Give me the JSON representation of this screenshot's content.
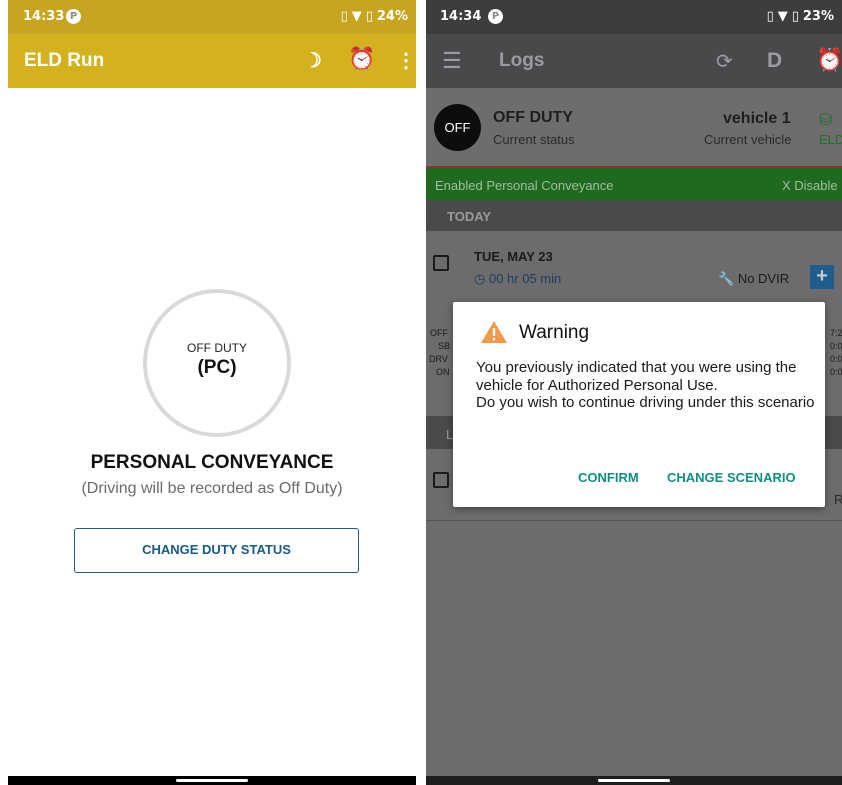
{
  "left": {
    "status_bar": {
      "time": "14:33",
      "battery": "24%"
    },
    "app_bar": {
      "title": "ELD Run"
    },
    "duty_ring": {
      "label": "OFF DUTY",
      "mode": "(PC)"
    },
    "mode_title": "PERSONAL CONVEYANCE",
    "mode_subtitle": "(Driving will be recorded as Off Duty)",
    "change_button": "CHANGE DUTY STATUS"
  },
  "right": {
    "status_bar": {
      "time": "14:34",
      "battery": "23%"
    },
    "app_bar": {
      "title": "Logs",
      "d_button": "D"
    },
    "current_status": {
      "badge": "OFF",
      "title": "OFF DUTY",
      "subtitle": "Current status",
      "vehicle": "vehicle 1",
      "vehicle_subtitle": "Current vehicle",
      "eld_label": "ELD"
    },
    "pc_bar": {
      "message": "Enabled Personal Conveyance",
      "action": "X Disable"
    },
    "section_today": "TODAY",
    "day": {
      "date": "TUE, MAY 23",
      "duration": "00 hr  05 min",
      "dvir": "No DVIR",
      "add": "+"
    },
    "graph_labels": [
      "OFF",
      "SB",
      "DRV",
      "ON"
    ],
    "graph_values": [
      "7:2",
      "0:0",
      "0:0",
      "0:0"
    ],
    "section_other": "L",
    "row2_tail": "R",
    "dialog": {
      "title": "Warning",
      "body_line1": "You previously indicated that you were using the vehicle for Authorized Personal Use.",
      "body_line2": "Do you wish to continue driving under this scenario",
      "confirm": "CONFIRM",
      "change": "CHANGE SCENARIO"
    }
  },
  "colors": {
    "brand_yellow": "#d4b11f",
    "pc_green": "#1f6a1e",
    "link_blue": "#1a5a86",
    "dialog_accent": "#0f8f82",
    "warning_orange": "#f29a4a"
  }
}
